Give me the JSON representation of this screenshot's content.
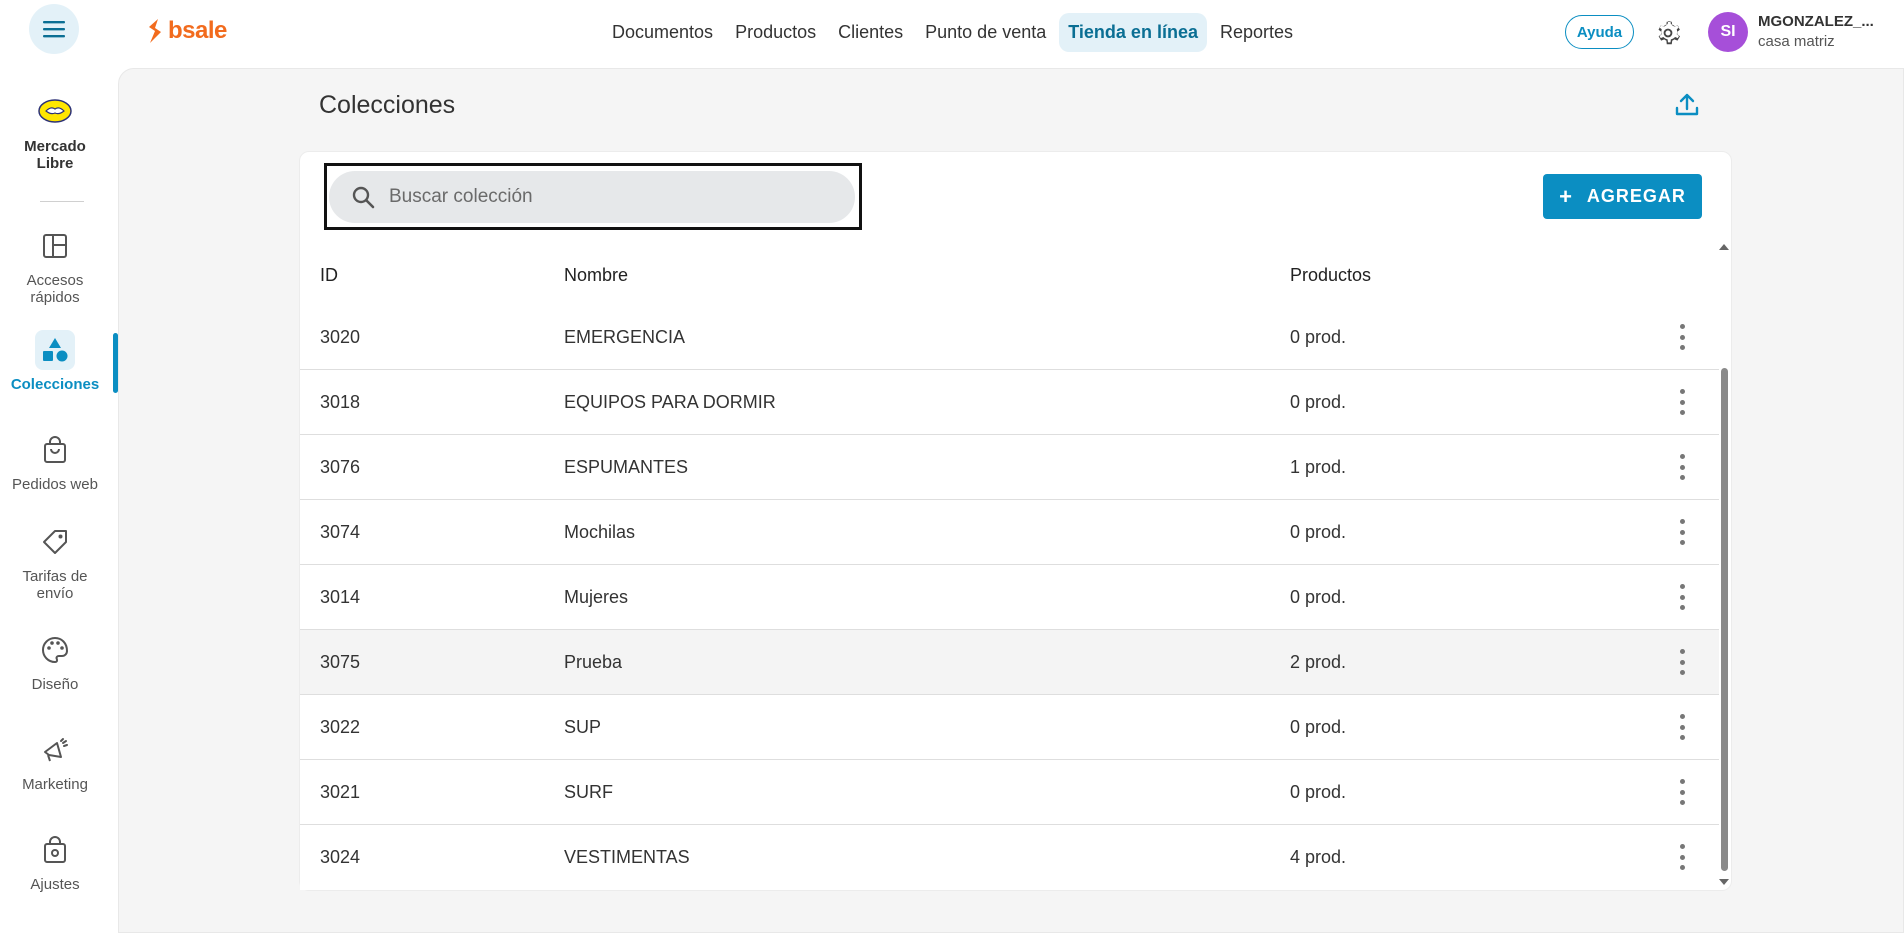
{
  "header": {
    "brand": "bsale",
    "nav": [
      "Documentos",
      "Productos",
      "Clientes",
      "Punto de venta",
      "Tienda en línea",
      "Reportes"
    ],
    "active_nav": "Tienda en línea",
    "help_label": "Ayuda",
    "user": {
      "initials": "SI",
      "name": "MGONZALEZ_...",
      "branch": "casa matriz"
    }
  },
  "sidebar": {
    "items": [
      {
        "label": "Mercado Libre",
        "icon": "mercadolibre-logo-icon"
      },
      {
        "label": "Accesos rápidos",
        "icon": "layout-panels-icon"
      },
      {
        "label": "Colecciones",
        "icon": "shapes-icon",
        "active": true
      },
      {
        "label": "Pedidos web",
        "icon": "shopping-bag-icon"
      },
      {
        "label": "Tarifas de envío",
        "icon": "tag-icon"
      },
      {
        "label": "Diseño",
        "icon": "palette-icon"
      },
      {
        "label": "Marketing",
        "icon": "megaphone-icon"
      },
      {
        "label": "Ajustes",
        "icon": "bag-gear-icon"
      }
    ]
  },
  "page": {
    "title": "Colecciones",
    "search_placeholder": "Buscar colección",
    "add_label": "AGREGAR",
    "columns": [
      "ID",
      "Nombre",
      "Productos"
    ],
    "rows": [
      {
        "id": "3020",
        "name": "EMERGENCIA",
        "products": "0 prod."
      },
      {
        "id": "3018",
        "name": "EQUIPOS PARA DORMIR",
        "products": "0 prod."
      },
      {
        "id": "3076",
        "name": "ESPUMANTES",
        "products": "1 prod."
      },
      {
        "id": "3074",
        "name": "Mochilas",
        "products": "0 prod."
      },
      {
        "id": "3014",
        "name": "Mujeres",
        "products": "0 prod."
      },
      {
        "id": "3075",
        "name": "Prueba",
        "products": "2 prod."
      },
      {
        "id": "3022",
        "name": "SUP",
        "products": "0 prod."
      },
      {
        "id": "3021",
        "name": "SURF",
        "products": "0 prod."
      },
      {
        "id": "3024",
        "name": "VESTIMENTAS",
        "products": "4 prod."
      }
    ],
    "highlighted_row": "3075"
  },
  "colors": {
    "accent": "#0b8ec2",
    "brand": "#f26b1d",
    "avatar": "#a64fd9"
  }
}
